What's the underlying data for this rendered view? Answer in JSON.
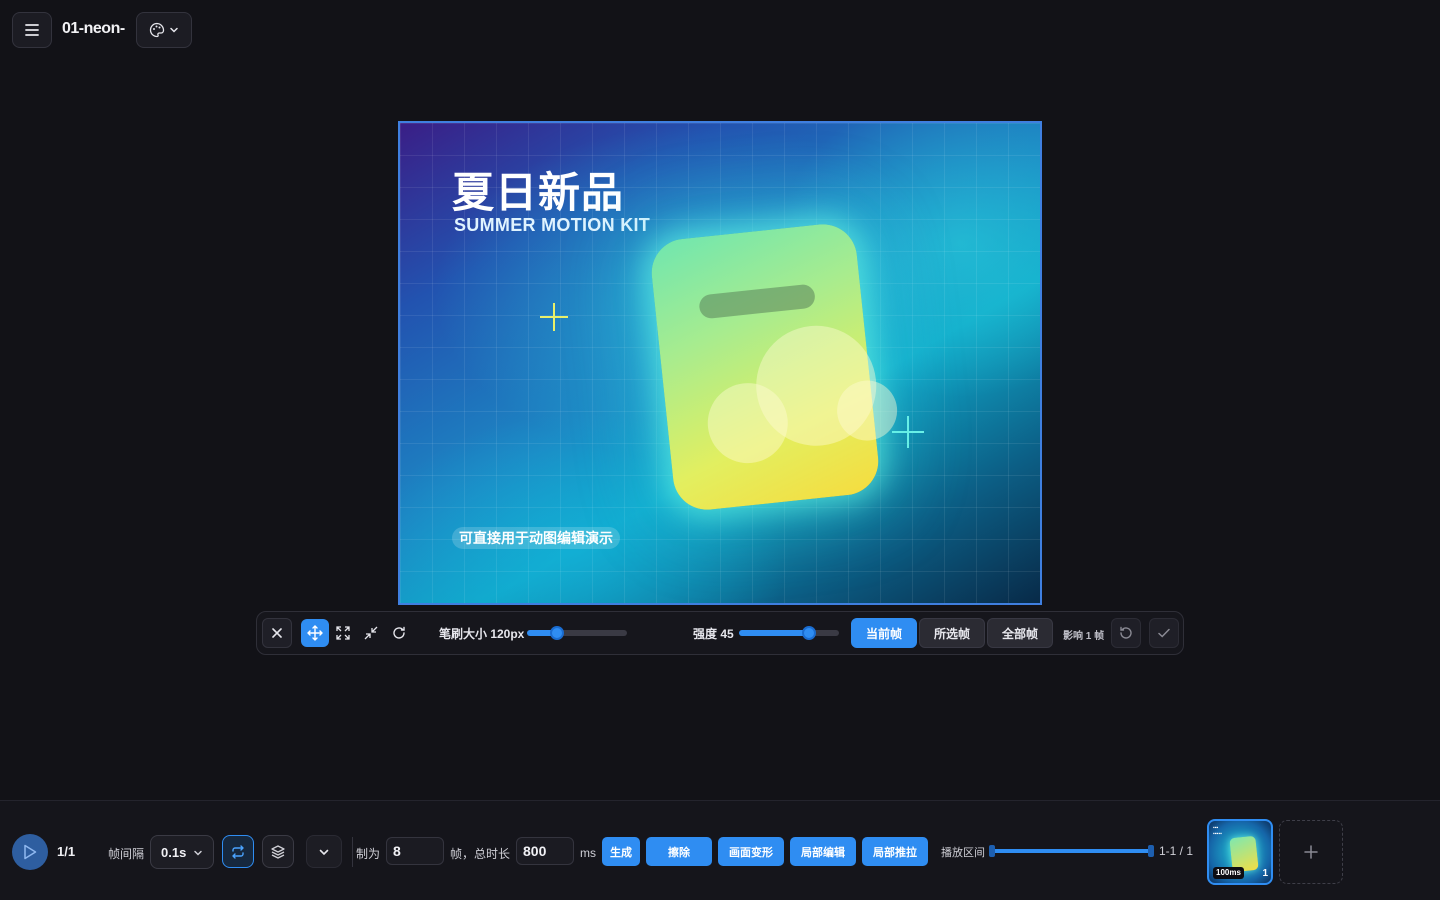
{
  "header": {
    "title": "01-neon-",
    "menu_icon": "hamburger-icon",
    "theme_icon": "palette-icon"
  },
  "canvas": {
    "heading": "夏日新品",
    "subheading": "SUMMER MOTION KIT",
    "note": "可直接用于动图编辑演示"
  },
  "edit_toolbar": {
    "tools": [
      "move-icon",
      "expand-icon",
      "shrink-icon",
      "rotate-icon"
    ],
    "active_tool": "move-icon",
    "brush_label": "笔刷大小 120px",
    "brush_value": 0.3,
    "strength_label": "强度 45",
    "strength_value": 0.7,
    "scope_options": [
      "当前帧",
      "所选帧",
      "全部帧"
    ],
    "scope_selected": "当前帧",
    "affect_label": "影响 1 帧"
  },
  "bottom_bar": {
    "frame_counter": "1/1",
    "interval_label": "帧间隔",
    "interval_value": "0.1s",
    "make_label": "制为",
    "frames_value": "8",
    "frames_unit_label": "帧，总时长",
    "duration_value": "800",
    "duration_unit": "ms",
    "actions": [
      "生成",
      "擦除",
      "画面变形",
      "局部编辑",
      "局部推拉"
    ],
    "range_label": "播放区间",
    "range_text": "1-1 / 1",
    "thumbnail": {
      "duration": "100ms",
      "index": "1"
    }
  },
  "colors": {
    "accent": "#2f8df2",
    "background": "#121217"
  }
}
